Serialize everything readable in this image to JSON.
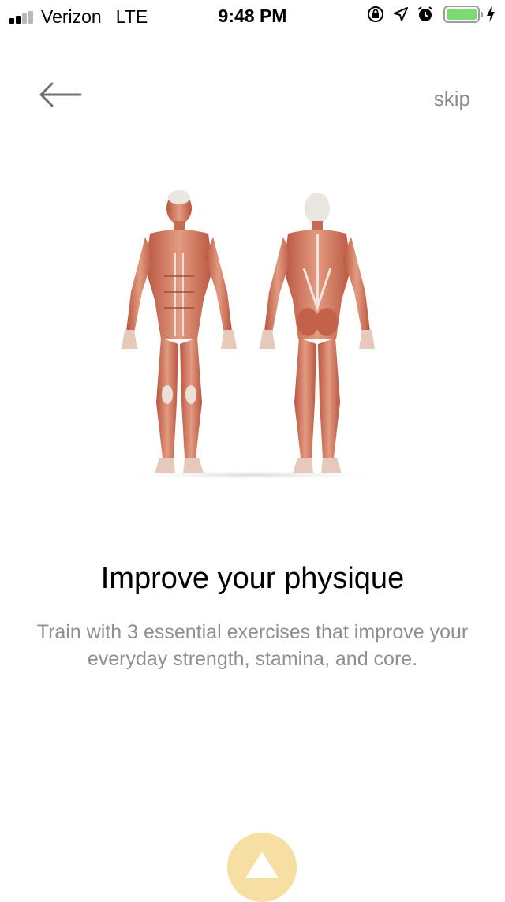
{
  "status_bar": {
    "carrier": "Verizon",
    "network": "LTE",
    "time": "9:48 PM",
    "signal_bars_active": 2,
    "signal_bars_total": 4,
    "battery_level": 1.0,
    "icons": [
      "orientation-lock-icon",
      "location-arrow-icon",
      "alarm-clock-icon",
      "battery-icon",
      "charging-bolt-icon"
    ],
    "battery_color": "#7ed873"
  },
  "nav": {
    "back_icon": "arrow-left-icon",
    "skip_label": "skip"
  },
  "illustration": {
    "icon": "muscle-anatomy-front-back"
  },
  "content": {
    "headline": "Improve your physique",
    "description": "Train with 3 essential exercises that improve your everyday strength, stamina, and core."
  },
  "next_button": {
    "icon": "triangle-up-icon",
    "color": "#f7dea2"
  }
}
